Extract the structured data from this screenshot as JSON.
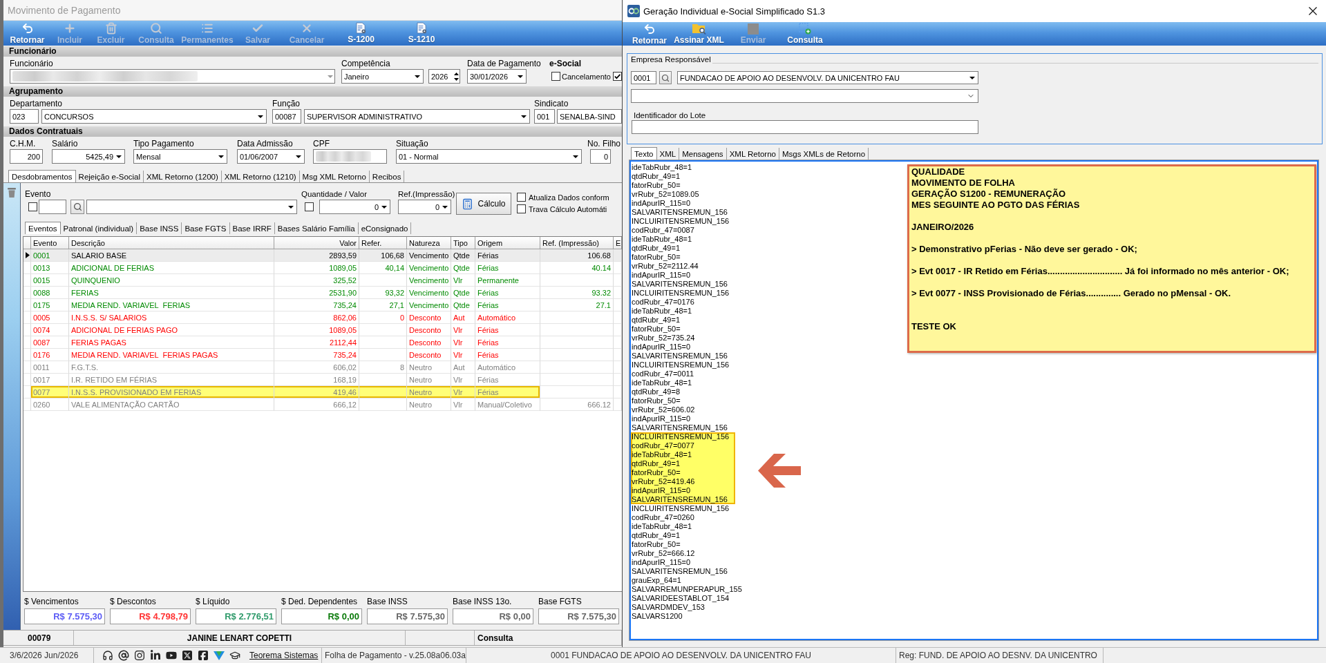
{
  "left_window": {
    "title": "Movimento de Pagamento",
    "toolbar": [
      {
        "label": "Retornar",
        "kind": "return",
        "disabled": false
      },
      {
        "label": "Incluir",
        "kind": "add",
        "disabled": true
      },
      {
        "label": "Excluir",
        "kind": "delete",
        "disabled": true
      },
      {
        "label": "Consulta",
        "kind": "search",
        "disabled": true
      },
      {
        "label": "Permanentes",
        "kind": "list",
        "disabled": true
      },
      {
        "label": "Salvar",
        "kind": "save",
        "disabled": true
      },
      {
        "label": "Cancelar",
        "kind": "cancel",
        "disabled": true
      },
      {
        "label": "S-1200",
        "kind": "document",
        "disabled": false
      },
      {
        "label": "S-1210",
        "kind": "document",
        "disabled": false
      }
    ],
    "funcionario": {
      "header": "Funcionário",
      "employee_label": "Funcionário",
      "competencia_label": "Competência",
      "competencia": "Janeiro",
      "year": "2026",
      "payment_date_label": "Data de Pagamento",
      "payment_date": "30/01/2026",
      "esocial_label": "e-Social",
      "esocial_options": [
        {
          "label": "Cancelamento",
          "checked": false
        },
        {
          "checked": true
        }
      ]
    },
    "agrupamento": {
      "header": "Agrupamento",
      "departamento_label": "Departamento",
      "departamento_code": "023",
      "departamento": "CONCURSOS",
      "funcao_label": "Função",
      "funcao_code": "00087",
      "funcao": "SUPERVISOR ADMINISTRATIVO",
      "sindicato_label": "Sindicato",
      "sindicato_code": "001",
      "sindicato": "SENALBA-SIND"
    },
    "dados_contratuais": {
      "header": "Dados Contratuais",
      "chm_label": "C.H.M.",
      "chm": "200",
      "salario_label": "Salário",
      "salario": "5425,49",
      "tipo_pagamento_label": "Tipo Pagamento",
      "tipo_pagamento": "Mensal",
      "data_admissao_label": "Data Admissão",
      "data_admissao": "01/06/2007",
      "cpf_label": "CPF",
      "situacao_label": "Situação",
      "situacao": "01 - Normal",
      "filhos_label": "No. Filho",
      "filhos": "0"
    },
    "tabs": [
      {
        "label": "Desdobramentos",
        "selected": true
      },
      {
        "label": "Rejeição e-Social",
        "selected": false
      },
      {
        "label": "XML Retorno (1200)",
        "selected": false
      },
      {
        "label": "XML Retorno (1210)",
        "selected": false
      },
      {
        "label": "Msg XML Retorno",
        "selected": false
      },
      {
        "label": "Recibos",
        "selected": false
      }
    ],
    "entry": {
      "evento_label": "Evento",
      "evento_checked": false,
      "quantidade_label": "Quantidade / Valor",
      "quantidade_checked": false,
      "quantidade": "0",
      "ref_label": "Ref.(Impressão)",
      "ref": "0",
      "calc_button": "Cálculo",
      "options": [
        {
          "label": "Atualiza Dados conform",
          "checked": false
        },
        {
          "label": "Trava Cálculo Automáti",
          "checked": false
        }
      ]
    },
    "sub_tabs": [
      {
        "label": "Eventos",
        "selected": true
      },
      {
        "label": "Patronal (individual)",
        "selected": false
      },
      {
        "label": "Base INSS",
        "selected": false
      },
      {
        "label": "Base FGTS",
        "selected": false
      },
      {
        "label": "Base IRRF",
        "selected": false
      },
      {
        "label": "Bases Salário Família",
        "selected": false
      },
      {
        "label": "eConsignado",
        "selected": false
      }
    ],
    "table": {
      "columns": [
        "Evento",
        "Descrição",
        "Valor",
        "Refer.",
        "Natureza",
        "Tipo",
        "Origem",
        "Ref. (Impressão)",
        "E"
      ],
      "rows": [
        {
          "evento": "0001",
          "descricao": "SALARIO BASE",
          "valor": "2893,59",
          "refer": "106,68",
          "natureza": "Vencimento",
          "tipo": "Qtde",
          "origem": "Férias",
          "ref_impressao": "106.68",
          "kind": "earning",
          "selected": true,
          "highlighted": false
        },
        {
          "evento": "0013",
          "descricao": "ADICIONAL DE FERIAS",
          "valor": "1089,05",
          "refer": "40,14",
          "natureza": "Vencimento",
          "tipo": "Qtde",
          "origem": "Férias",
          "ref_impressao": "40.14",
          "kind": "earning",
          "selected": false,
          "highlighted": false
        },
        {
          "evento": "0015",
          "descricao": "QUINQUENIO",
          "valor": "325,52",
          "natureza": "Vencimento",
          "tipo": "Vlr",
          "origem": "Permanente",
          "kind": "earning",
          "selected": false,
          "highlighted": false
        },
        {
          "evento": "0088",
          "descricao": "FERIAS",
          "valor": "2531,90",
          "refer": "93,32",
          "natureza": "Vencimento",
          "tipo": "Qtde",
          "origem": "Férias",
          "ref_impressao": "93.32",
          "kind": "earning",
          "selected": false,
          "highlighted": false
        },
        {
          "evento": "0175",
          "descricao": "MEDIA REND. VARIAVEL  FERIAS",
          "valor": "735,24",
          "refer": "27,1",
          "natureza": "Vencimento",
          "tipo": "Qtde",
          "origem": "Férias",
          "ref_impressao": "27.1",
          "kind": "earning",
          "selected": false,
          "highlighted": false
        },
        {
          "evento": "0005",
          "descricao": "I.N.S.S. S/ SALARIOS",
          "valor": "862,06",
          "refer": "0",
          "natureza": "Desconto",
          "tipo": "Aut",
          "origem": "Automático",
          "kind": "deduction",
          "selected": false,
          "highlighted": false
        },
        {
          "evento": "0074",
          "descricao": "ADICIONAL DE FERIAS PAGO",
          "valor": "1089,05",
          "natureza": "Desconto",
          "tipo": "Vlr",
          "origem": "Férias",
          "kind": "deduction",
          "selected": false,
          "highlighted": false
        },
        {
          "evento": "0087",
          "descricao": "FERIAS PAGAS",
          "valor": "2112,44",
          "natureza": "Desconto",
          "tipo": "Vlr",
          "origem": "Férias",
          "kind": "deduction",
          "selected": false,
          "highlighted": false
        },
        {
          "evento": "0176",
          "descricao": "MEDIA REND. VARIAVEL  FERIAS PAGAS",
          "valor": "735,24",
          "natureza": "Desconto",
          "tipo": "Vlr",
          "origem": "Férias",
          "kind": "deduction",
          "selected": false,
          "highlighted": false
        },
        {
          "evento": "0011",
          "descricao": "F.G.T.S.",
          "valor": "606,02",
          "refer": "8",
          "natureza": "Neutro",
          "tipo": "Aut",
          "origem": "Automático",
          "kind": "neutral",
          "selected": false,
          "highlighted": false
        },
        {
          "evento": "0017",
          "descricao": "I.R. RETIDO EM FÉRIAS",
          "valor": "168,19",
          "natureza": "Neutro",
          "tipo": "Vlr",
          "origem": "Férias",
          "kind": "neutral",
          "selected": false,
          "highlighted": false
        },
        {
          "evento": "0077",
          "descricao": "I.N.S.S. PROVISIONADO EM FERIAS",
          "valor": "419,46",
          "natureza": "Neutro",
          "tipo": "Vlr",
          "origem": "Férias",
          "kind": "neutral",
          "selected": false,
          "highlighted": true
        },
        {
          "evento": "0260",
          "descricao": "VALE ALIMENTAÇÃO CARTÃO",
          "valor": "666,12",
          "natureza": "Neutro",
          "tipo": "Vlr",
          "origem": "Manual/Coletivo",
          "ref_impressao": "666.12",
          "kind": "neutral",
          "selected": false,
          "highlighted": false
        }
      ]
    },
    "totals": [
      {
        "label": "$ Vencimentos",
        "value": "R$ 7.575,30",
        "color": "#5b5bf5"
      },
      {
        "label": "$ Descontos",
        "value": "R$ 4.798,79",
        "color": "#ff3333"
      },
      {
        "label": "$ Líquido",
        "value": "R$ 2.776,51",
        "color": "#2e9a6a"
      },
      {
        "label": "$ Ded. Dependentes",
        "value": "R$ 0,00",
        "color": "#0a7a0a"
      },
      {
        "label": "Base INSS",
        "value": "R$ 7.575,30",
        "color": "#666666"
      },
      {
        "label": "Base INSS 13o.",
        "value": "R$ 0,00",
        "color": "#666666"
      },
      {
        "label": "Base FGTS",
        "value": "R$ 7.575,30",
        "color": "#666666"
      }
    ],
    "footer": {
      "code": "00079",
      "name": "JANINE LENART COPETTI",
      "mode": "Consulta"
    }
  },
  "right_window": {
    "title": "Geração Individual e-Social Simplificado S1.3",
    "toolbar": [
      {
        "label": "Retornar",
        "kind": "return",
        "disabled": false
      },
      {
        "label": "Assinar XML",
        "kind": "folder",
        "disabled": false
      },
      {
        "label": "Enviar",
        "kind": "stop",
        "disabled": true
      },
      {
        "label": "Consulta",
        "kind": "query",
        "disabled": false
      }
    ],
    "empresa": {
      "legend": "Empresa Responsável",
      "code": "0001",
      "name": "FUNDACAO DE APOIO AO DESENVOLV. DA UNICENTRO FAU"
    },
    "lote_label": "Identificador do Lote",
    "tabs": [
      {
        "label": "Texto",
        "selected": true
      },
      {
        "label": "XML",
        "selected": false
      },
      {
        "label": "Mensagens",
        "selected": false
      },
      {
        "label": "XML Retorno",
        "selected": false
      },
      {
        "label": "Msgs XMLs de Retorno",
        "selected": false
      }
    ],
    "memo": {
      "lines": [
        {
          "text": "ideTabRubr_48=1",
          "highlighted": false
        },
        {
          "text": "qtdRubr_49=1",
          "highlighted": false
        },
        {
          "text": "fatorRubr_50=",
          "highlighted": false
        },
        {
          "text": "vrRubr_52=1089.05",
          "highlighted": false
        },
        {
          "text": "indApurIR_115=0",
          "highlighted": false
        },
        {
          "text": "SALVARITENSREMUN_156",
          "highlighted": false
        },
        {
          "text": "INCLUIRITENSREMUN_156",
          "highlighted": false
        },
        {
          "text": "codRubr_47=0087",
          "highlighted": false
        },
        {
          "text": "ideTabRubr_48=1",
          "highlighted": false
        },
        {
          "text": "qtdRubr_49=1",
          "highlighted": false
        },
        {
          "text": "fatorRubr_50=",
          "highlighted": false
        },
        {
          "text": "vrRubr_52=2112.44",
          "highlighted": false
        },
        {
          "text": "indApurIR_115=0",
          "highlighted": false
        },
        {
          "text": "SALVARITENSREMUN_156",
          "highlighted": false
        },
        {
          "text": "INCLUIRITENSREMUN_156",
          "highlighted": false
        },
        {
          "text": "codRubr_47=0176",
          "highlighted": false
        },
        {
          "text": "ideTabRubr_48=1",
          "highlighted": false
        },
        {
          "text": "qtdRubr_49=1",
          "highlighted": false
        },
        {
          "text": "fatorRubr_50=",
          "highlighted": false
        },
        {
          "text": "vrRubr_52=735.24",
          "highlighted": false
        },
        {
          "text": "indApurIR_115=0",
          "highlighted": false
        },
        {
          "text": "SALVARITENSREMUN_156",
          "highlighted": false
        },
        {
          "text": "INCLUIRITENSREMUN_156",
          "highlighted": false
        },
        {
          "text": "codRubr_47=0011",
          "highlighted": false
        },
        {
          "text": "ideTabRubr_48=1",
          "highlighted": false
        },
        {
          "text": "qtdRubr_49=8",
          "highlighted": false
        },
        {
          "text": "fatorRubr_50=",
          "highlighted": false
        },
        {
          "text": "vrRubr_52=606.02",
          "highlighted": false
        },
        {
          "text": "indApurIR_115=0",
          "highlighted": false
        },
        {
          "text": "SALVARITENSREMUN_156",
          "highlighted": false
        },
        {
          "text": "INCLUIRITENSREMUN_156",
          "highlighted": true
        },
        {
          "text": "codRubr_47=0077",
          "highlighted": true
        },
        {
          "text": "ideTabRubr_48=1",
          "highlighted": true
        },
        {
          "text": "qtdRubr_49=1",
          "highlighted": true
        },
        {
          "text": "fatorRubr_50=",
          "highlighted": true
        },
        {
          "text": "vrRubr_52=419.46",
          "highlighted": true
        },
        {
          "text": "indApurIR_115=0",
          "highlighted": true
        },
        {
          "text": "SALVARITENSREMUN_156",
          "highlighted": true
        },
        {
          "text": "INCLUIRITENSREMUN_156",
          "highlighted": false
        },
        {
          "text": "codRubr_47=0260",
          "highlighted": false
        },
        {
          "text": "ideTabRubr_48=1",
          "highlighted": false
        },
        {
          "text": "qtdRubr_49=1",
          "highlighted": false
        },
        {
          "text": "fatorRubr_50=",
          "highlighted": false
        },
        {
          "text": "vrRubr_52=666.12",
          "highlighted": false
        },
        {
          "text": "indApurIR_115=0",
          "highlighted": false
        },
        {
          "text": "SALVARITENSREMUN_156",
          "highlighted": false
        },
        {
          "text": "grauExp_64=1",
          "highlighted": false
        },
        {
          "text": "SALVARREMUNPERAPUR_155",
          "highlighted": false
        },
        {
          "text": "SALVARIDEESTABLOT_154",
          "highlighted": false
        },
        {
          "text": "SALVARDMDEV_153",
          "highlighted": false
        },
        {
          "text": "SALVARS1200",
          "highlighted": false
        }
      ]
    },
    "note": {
      "blocks": [
        [
          "QUALIDADE",
          "MOVIMENTO DE FOLHA",
          "GERAÇÃO S1200 - REMUNERAÇÃO",
          "MES SEGUINTE AO PGTO DAS FÉRIAS"
        ],
        [
          "JANEIRO/2026"
        ],
        [
          "> Demonstrativo pFerias - Não deve ser gerado - OK;"
        ],
        [
          "> Evt 0017 - IR Retido em Férias.............................. Já foi informado no mês anterior - OK;"
        ],
        [
          "> Evt 0077 - INSS Provisionado de Férias.............. Gerado no pMensal - OK."
        ]
      ],
      "result": "TESTE OK"
    }
  },
  "status_bar": {
    "date": "3/6/2026 Jun/2026",
    "link": "Teorema Sistemas",
    "version": "Folha de Pagamento - v.25.08a06.03a",
    "company": "0001 FUNDACAO DE APOIO AO DESENVOLV. DA UNICENTRO FAU",
    "registration": "Reg: FUND. DE APOIO AO DESNV. DA UNICENTRO"
  }
}
